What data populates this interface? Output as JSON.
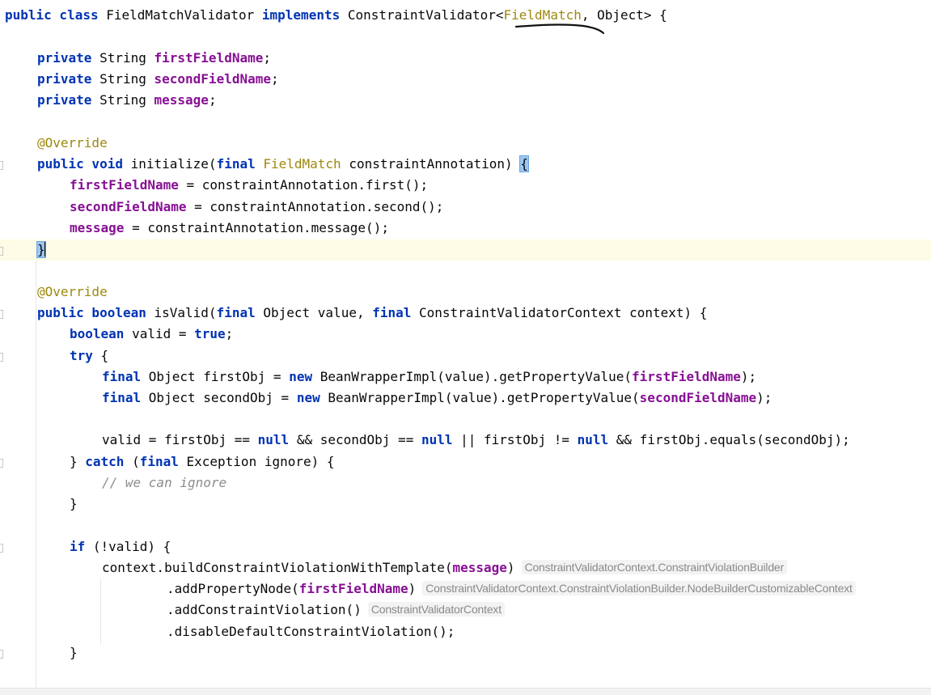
{
  "editor": {
    "lines": [
      {
        "id": "l1",
        "indent": 0,
        "tokens": [
          [
            "kw",
            "public class "
          ],
          [
            "plain",
            "FieldMatchValidator "
          ],
          [
            "kw",
            "implements "
          ],
          [
            "plain",
            "ConstraintValidator<"
          ],
          [
            "type-ann",
            "FieldMatch"
          ],
          [
            "plain",
            ", Object> {"
          ]
        ]
      },
      {
        "id": "l2",
        "indent": 0,
        "tokens": []
      },
      {
        "id": "l3",
        "indent": 1,
        "tokens": [
          [
            "kw",
            "private "
          ],
          [
            "plain",
            "String "
          ],
          [
            "field",
            "firstFieldName"
          ],
          [
            "plain",
            ";"
          ]
        ]
      },
      {
        "id": "l4",
        "indent": 1,
        "tokens": [
          [
            "kw",
            "private "
          ],
          [
            "plain",
            "String "
          ],
          [
            "field",
            "secondFieldName"
          ],
          [
            "plain",
            ";"
          ]
        ]
      },
      {
        "id": "l5",
        "indent": 1,
        "tokens": [
          [
            "kw",
            "private "
          ],
          [
            "plain",
            "String "
          ],
          [
            "field",
            "message"
          ],
          [
            "plain",
            ";"
          ]
        ]
      },
      {
        "id": "l6",
        "indent": 0,
        "tokens": []
      },
      {
        "id": "l7",
        "indent": 1,
        "tokens": [
          [
            "ann",
            "@Override"
          ]
        ]
      },
      {
        "id": "l8",
        "indent": 1,
        "tokens": [
          [
            "kw",
            "public void "
          ],
          [
            "plain",
            "initialize("
          ],
          [
            "kw",
            "final "
          ],
          [
            "type-ann",
            "FieldMatch "
          ],
          [
            "plain",
            "constraintAnnotation) "
          ],
          [
            "brace",
            "{"
          ]
        ]
      },
      {
        "id": "l9",
        "indent": 2,
        "tokens": [
          [
            "field",
            "firstFieldName"
          ],
          [
            "plain",
            " = constraintAnnotation.first();"
          ]
        ]
      },
      {
        "id": "l10",
        "indent": 2,
        "tokens": [
          [
            "field",
            "secondFieldName"
          ],
          [
            "plain",
            " = constraintAnnotation.second();"
          ]
        ]
      },
      {
        "id": "l11",
        "indent": 2,
        "tokens": [
          [
            "field",
            "message"
          ],
          [
            "plain",
            " = constraintAnnotation.message();"
          ]
        ]
      },
      {
        "id": "l12",
        "indent": 1,
        "current": true,
        "tokens": [
          [
            "brace",
            "}"
          ],
          [
            "caret",
            ""
          ]
        ]
      },
      {
        "id": "l13",
        "indent": 0,
        "tokens": []
      },
      {
        "id": "l14",
        "indent": 1,
        "tokens": [
          [
            "ann",
            "@Override"
          ]
        ]
      },
      {
        "id": "l15",
        "indent": 1,
        "tokens": [
          [
            "kw",
            "public boolean "
          ],
          [
            "plain",
            "isValid("
          ],
          [
            "kw",
            "final "
          ],
          [
            "plain",
            "Object value, "
          ],
          [
            "kw",
            "final "
          ],
          [
            "plain",
            "ConstraintValidatorContext context) {"
          ]
        ]
      },
      {
        "id": "l16",
        "indent": 2,
        "tokens": [
          [
            "kw",
            "boolean "
          ],
          [
            "plain",
            "valid = "
          ],
          [
            "kw",
            "true"
          ],
          [
            "plain",
            ";"
          ]
        ]
      },
      {
        "id": "l17",
        "indent": 2,
        "tokens": [
          [
            "kw",
            "try "
          ],
          [
            "plain",
            "{"
          ]
        ]
      },
      {
        "id": "l18",
        "indent": 3,
        "tokens": [
          [
            "kw",
            "final "
          ],
          [
            "plain",
            "Object firstObj = "
          ],
          [
            "kw",
            "new "
          ],
          [
            "plain",
            "BeanWrapperImpl(value).getPropertyValue("
          ],
          [
            "field",
            "firstFieldName"
          ],
          [
            "plain",
            ");"
          ]
        ]
      },
      {
        "id": "l19",
        "indent": 3,
        "tokens": [
          [
            "kw",
            "final "
          ],
          [
            "plain",
            "Object secondObj = "
          ],
          [
            "kw",
            "new "
          ],
          [
            "plain",
            "BeanWrapperImpl(value).getPropertyValue("
          ],
          [
            "field",
            "secondFieldName"
          ],
          [
            "plain",
            ");"
          ]
        ]
      },
      {
        "id": "l20",
        "indent": 0,
        "tokens": []
      },
      {
        "id": "l21",
        "indent": 3,
        "tokens": [
          [
            "plain",
            "valid = firstObj == "
          ],
          [
            "kw",
            "null "
          ],
          [
            "plain",
            "&& secondObj == "
          ],
          [
            "kw",
            "null "
          ],
          [
            "plain",
            "|| firstObj != "
          ],
          [
            "kw",
            "null "
          ],
          [
            "plain",
            "&& firstObj.equals(secondObj);"
          ]
        ]
      },
      {
        "id": "l22",
        "indent": 2,
        "tokens": [
          [
            "plain",
            "} "
          ],
          [
            "kw",
            "catch "
          ],
          [
            "plain",
            "("
          ],
          [
            "kw",
            "final "
          ],
          [
            "plain",
            "Exception ignore) {"
          ]
        ]
      },
      {
        "id": "l23",
        "indent": 3,
        "tokens": [
          [
            "cmt",
            "// we can ignore"
          ]
        ]
      },
      {
        "id": "l24",
        "indent": 2,
        "tokens": [
          [
            "plain",
            "}"
          ]
        ]
      },
      {
        "id": "l25",
        "indent": 0,
        "tokens": []
      },
      {
        "id": "l26",
        "indent": 2,
        "tokens": [
          [
            "kw",
            "if "
          ],
          [
            "plain",
            "(!valid) {"
          ]
        ]
      },
      {
        "id": "l27",
        "indent": 3,
        "tokens": [
          [
            "plain",
            "context.buildConstraintViolationWithTemplate("
          ],
          [
            "field",
            "message"
          ],
          [
            "plain",
            ")"
          ],
          [
            "hint",
            "ConstraintValidatorContext.ConstraintViolationBuilder"
          ]
        ]
      },
      {
        "id": "l28",
        "indent": 5,
        "tokens": [
          [
            "plain",
            ".addPropertyNode("
          ],
          [
            "field",
            "firstFieldName"
          ],
          [
            "plain",
            ")"
          ],
          [
            "hint",
            "ConstraintValidatorContext.ConstraintViolationBuilder.NodeBuilderCustomizableContext"
          ]
        ]
      },
      {
        "id": "l29",
        "indent": 5,
        "tokens": [
          [
            "plain",
            ".addConstraintViolation()"
          ],
          [
            "hint",
            "ConstraintValidatorContext"
          ]
        ]
      },
      {
        "id": "l30",
        "indent": 5,
        "tokens": [
          [
            "plain",
            ".disableDefaultConstraintViolation();"
          ]
        ]
      },
      {
        "id": "l31",
        "indent": 2,
        "tokens": [
          [
            "plain",
            "}"
          ]
        ]
      }
    ]
  }
}
